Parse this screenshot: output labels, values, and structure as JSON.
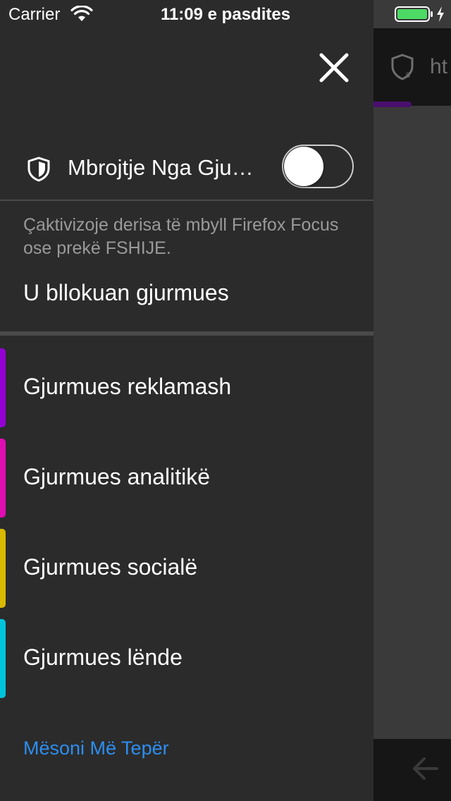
{
  "status_bar": {
    "carrier": "Carrier",
    "time": "11:09 e pasdites",
    "battery_color": "#4cd964"
  },
  "background_browser": {
    "url_text": "ht",
    "progress_color": "#4a0f6e"
  },
  "drawer": {
    "close_icon": "close-icon",
    "protection": {
      "icon": "shield-icon",
      "label": "Mbrojtje Nga Gju…",
      "toggle_on": false
    },
    "description": "Çaktivizoje derisa të mbyll Firefox Focus ose prekë FSHIJE.",
    "blocked_heading": "U bllokuan gjurmues",
    "trackers": [
      {
        "label": "Gjurmues reklamash",
        "color": "#9400d3"
      },
      {
        "label": "Gjurmues analitikë",
        "color": "#e00db0"
      },
      {
        "label": "Gjurmues socialë",
        "color": "#d9b800"
      },
      {
        "label": "Gjurmues lënde",
        "color": "#00c4d9"
      }
    ],
    "learn_more": "Mësoni Më Tepër",
    "link_color": "#2d8ef0"
  }
}
